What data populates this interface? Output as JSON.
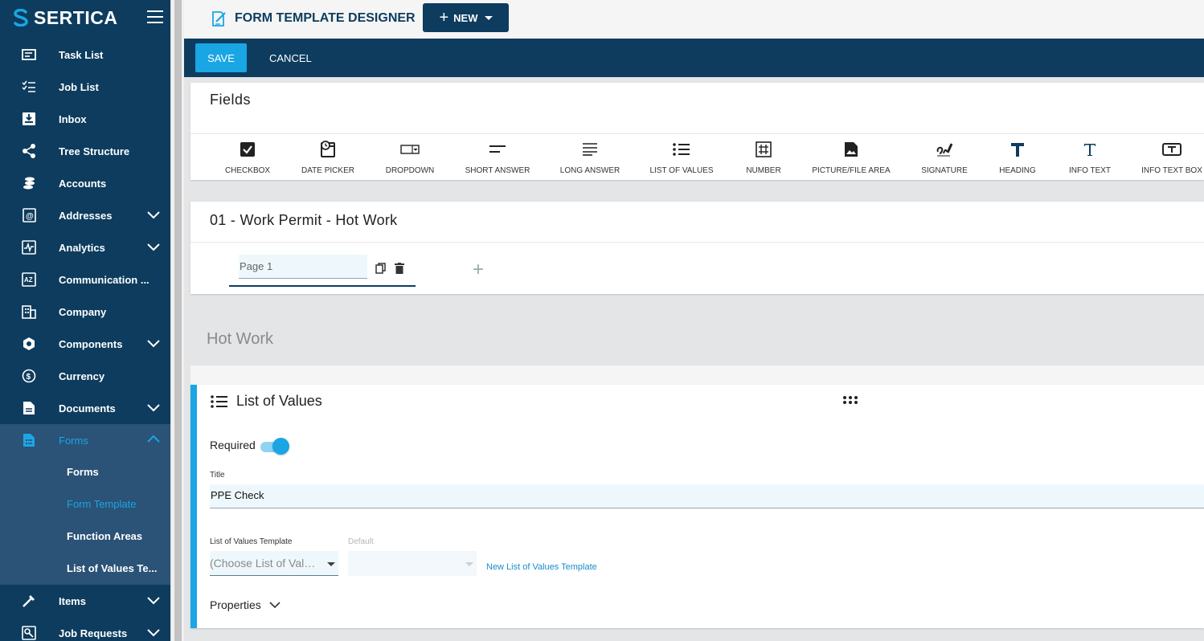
{
  "brand": {
    "name": "SERTICA"
  },
  "colors": {
    "sidebar": "#0d3c5e",
    "accent": "#1aa6e4",
    "submenu": "#2b5277"
  },
  "sidebar": {
    "items": [
      {
        "label": "Task List",
        "icon": "task-list-icon"
      },
      {
        "label": "Job List",
        "icon": "job-list-icon"
      },
      {
        "label": "Inbox",
        "icon": "inbox-icon"
      },
      {
        "label": "Tree Structure",
        "icon": "tree-structure-icon"
      },
      {
        "label": "Accounts",
        "icon": "accounts-icon"
      },
      {
        "label": "Addresses",
        "icon": "addresses-icon"
      },
      {
        "label": "Analytics",
        "icon": "analytics-icon"
      },
      {
        "label": "Communication ...",
        "icon": "communication-icon"
      },
      {
        "label": "Company",
        "icon": "company-icon"
      },
      {
        "label": "Components",
        "icon": "components-icon"
      },
      {
        "label": "Currency",
        "icon": "currency-icon"
      },
      {
        "label": "Documents",
        "icon": "documents-icon"
      },
      {
        "label": "Forms",
        "icon": "forms-icon"
      },
      {
        "label": "Items",
        "icon": "items-icon"
      },
      {
        "label": "Job Requests",
        "icon": "job-requests-icon"
      }
    ],
    "forms_submenu": [
      "Forms",
      "Form Template",
      "Function Areas",
      "List of Values Te..."
    ]
  },
  "header": {
    "title": "FORM TEMPLATE DESIGNER",
    "new_label": "NEW"
  },
  "actions": {
    "save": "SAVE",
    "cancel": "CANCEL"
  },
  "fields_panel": {
    "title": "Fields",
    "tools": [
      "CHECKBOX",
      "DATE PICKER",
      "DROPDOWN",
      "SHORT ANSWER",
      "LONG ANSWER",
      "LIST OF VALUES",
      "NUMBER",
      "PICTURE/FILE AREA",
      "SIGNATURE",
      "HEADING",
      "INFO TEXT",
      "INFO TEXT BOX"
    ]
  },
  "template": {
    "name": "01 - Work Permit - Hot Work",
    "page_value": "Page 1"
  },
  "section": {
    "title": "Hot Work"
  },
  "field": {
    "type_label": "List of Values",
    "required_label": "Required",
    "required_on": true,
    "title_label": "Title",
    "title_value": "PPE Check",
    "lov_template_label": "List of Values Template",
    "lov_template_placeholder": "(Choose List of Values Template)",
    "default_label": "Default",
    "new_lov_link": "New List of Values Template",
    "properties_label": "Properties"
  }
}
